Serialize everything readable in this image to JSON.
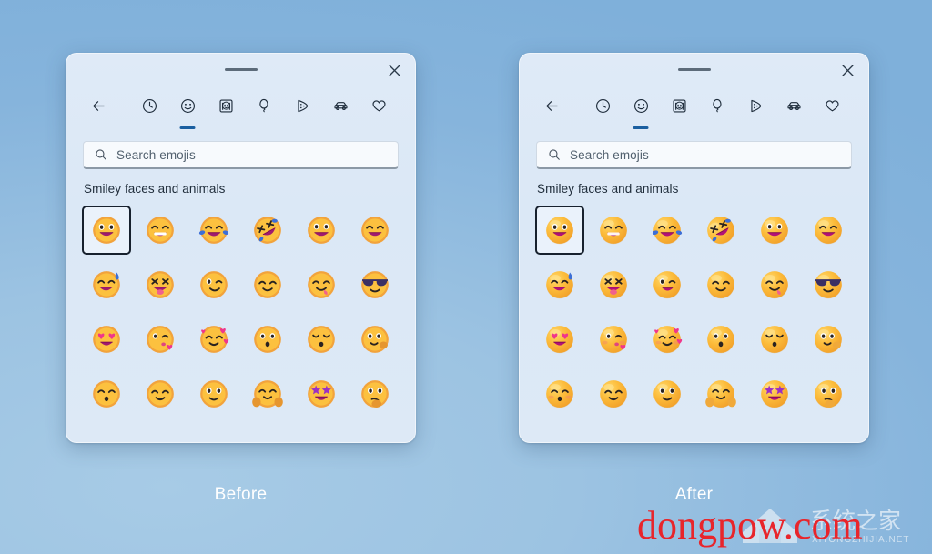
{
  "background": {
    "color_top": "#86b4dc",
    "color_bottom": "#a7cbe6"
  },
  "accent": {
    "tab_underline": "#1a5fa0",
    "focus_ring": "#17212e",
    "watermark_red": "#e8252b"
  },
  "panels": [
    {
      "id": "before",
      "caption": "Before",
      "titlebar": {
        "drag_handle": "drag-handle",
        "close_label": "✕"
      },
      "tabs": [
        {
          "name": "back",
          "label": "Back",
          "active": false
        },
        {
          "name": "recent",
          "label": "Recently used",
          "active": false
        },
        {
          "name": "smileys",
          "label": "Smiley faces and animals",
          "active": true
        },
        {
          "name": "people",
          "label": "People",
          "active": false
        },
        {
          "name": "celebration",
          "label": "Celebration and objects",
          "active": false
        },
        {
          "name": "food",
          "label": "Food and plants",
          "active": false
        },
        {
          "name": "travel",
          "label": "Transport and places",
          "active": false
        },
        {
          "name": "symbols",
          "label": "Symbols",
          "active": false
        }
      ],
      "search": {
        "placeholder": "Search emojis",
        "value": ""
      },
      "section_title": "Smiley faces and animals",
      "style": "flat-2d",
      "grid": {
        "columns": 6,
        "rows": 4,
        "selected_index": 0,
        "emojis": [
          "grinning-face-big-eyes",
          "beaming-face-smiling-eyes",
          "face-with-tears-of-joy",
          "rolling-on-the-floor-laughing",
          "grinning-face",
          "grinning-face-smiling-eyes",
          "grinning-face-sweat",
          "squinting-face-with-tongue",
          "winking-face",
          "smiling-face-smiling-eyes",
          "face-savoring-food",
          "smiling-face-with-sunglasses",
          "smiling-face-with-heart-eyes",
          "face-blowing-a-kiss",
          "smiling-face-with-hearts",
          "kissing-face",
          "kissing-face-closed-eyes",
          "face-with-hand-over-mouth",
          "kissing-face-smiling-eyes",
          "slightly-smiling-face",
          "neutral-smiling-face",
          "smiling-face-with-open-hands",
          "star-struck",
          "thinking-face"
        ]
      }
    },
    {
      "id": "after",
      "caption": "After",
      "titlebar": {
        "drag_handle": "drag-handle",
        "close_label": "✕"
      },
      "tabs": [
        {
          "name": "back",
          "label": "Back",
          "active": false
        },
        {
          "name": "recent",
          "label": "Recently used",
          "active": false
        },
        {
          "name": "smileys",
          "label": "Smiley faces and animals",
          "active": true
        },
        {
          "name": "people",
          "label": "People",
          "active": false
        },
        {
          "name": "celebration",
          "label": "Celebration and objects",
          "active": false
        },
        {
          "name": "food",
          "label": "Food and plants",
          "active": false
        },
        {
          "name": "travel",
          "label": "Transport and places",
          "active": false
        },
        {
          "name": "symbols",
          "label": "Symbols",
          "active": false
        }
      ],
      "search": {
        "placeholder": "Search emojis",
        "value": ""
      },
      "section_title": "Smiley faces and animals",
      "style": "fluent-3d",
      "grid": {
        "columns": 6,
        "rows": 4,
        "selected_index": 0,
        "emojis": [
          "grinning-face-big-eyes",
          "beaming-face-smiling-eyes",
          "face-with-tears-of-joy",
          "rolling-on-the-floor-laughing",
          "grinning-face",
          "grinning-face-smiling-eyes",
          "grinning-face-sweat",
          "squinting-face-with-tongue",
          "winking-face",
          "smiling-face-smiling-eyes",
          "face-savoring-food",
          "smiling-face-with-sunglasses",
          "smiling-face-with-heart-eyes",
          "face-blowing-a-kiss",
          "smiling-face-with-hearts",
          "kissing-face",
          "kissing-face-closed-eyes",
          "face-with-hand-over-mouth",
          "kissing-face-smiling-eyes",
          "slightly-smiling-face",
          "neutral-smiling-face",
          "smiling-face-with-open-hands",
          "star-struck",
          "thinking-face"
        ]
      }
    }
  ],
  "watermark": {
    "text": "dongpow.com",
    "logo_text": "系统之家",
    "logo_subtext": "XITONGZHIJIA.NET"
  }
}
